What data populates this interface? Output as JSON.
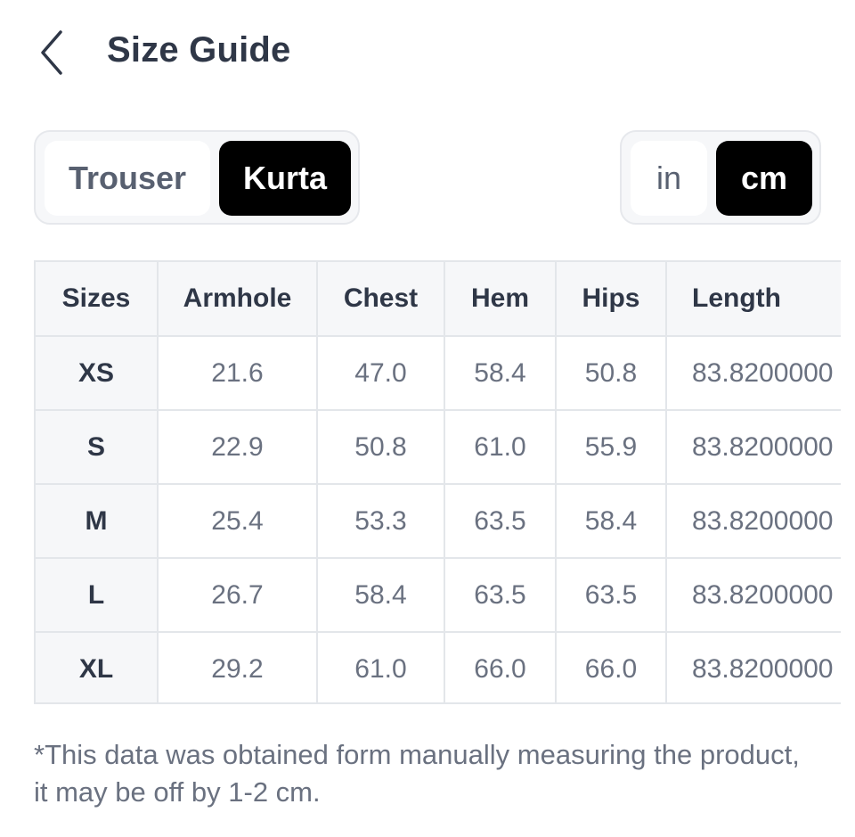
{
  "header": {
    "title": "Size Guide"
  },
  "garment_tabs": {
    "items": [
      "Trouser",
      "Kurta"
    ],
    "selected": "Kurta"
  },
  "unit_tabs": {
    "items": [
      "in",
      "cm"
    ],
    "selected": "cm"
  },
  "table": {
    "columns": [
      "Sizes",
      "Armhole",
      "Chest",
      "Hem",
      "Hips",
      "Length"
    ],
    "rows": [
      [
        "XS",
        "21.6",
        "47.0",
        "58.4",
        "50.8",
        "83.8200000"
      ],
      [
        "S",
        "22.9",
        "50.8",
        "61.0",
        "55.9",
        "83.8200000"
      ],
      [
        "M",
        "25.4",
        "53.3",
        "63.5",
        "58.4",
        "83.8200000"
      ],
      [
        "L",
        "26.7",
        "58.4",
        "63.5",
        "63.5",
        "83.8200000"
      ],
      [
        "XL",
        "29.2",
        "61.0",
        "66.0",
        "66.0",
        "83.8200000"
      ]
    ]
  },
  "note": "*This data was obtained form manually measuring the product, it may be off by 1-2 cm."
}
